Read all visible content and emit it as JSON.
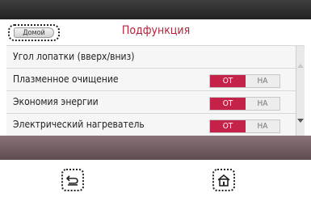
{
  "header": {
    "back_label": "Домой",
    "title": "Подфункция"
  },
  "rows": [
    {
      "label": "Угол лопатки (вверх/вниз)"
    },
    {
      "label": "Плазменное очищение",
      "on_label": "ОТ",
      "off_label": "НА"
    },
    {
      "label": "Экономия энергии",
      "on_label": "ОТ",
      "off_label": "НА"
    },
    {
      "label": "Электрический нагреватель",
      "on_label": "ОТ",
      "off_label": "НА"
    }
  ],
  "icons": {
    "scroll_up": "chevron-up-icon",
    "scroll_down": "chevron-down-icon",
    "back": "back-arrow-icon",
    "home": "home-icon"
  },
  "colors": {
    "accent": "#c5224a",
    "title": "#b0253c",
    "device_top": "#2a2a2a",
    "device_bottom": "#6f5c60"
  }
}
